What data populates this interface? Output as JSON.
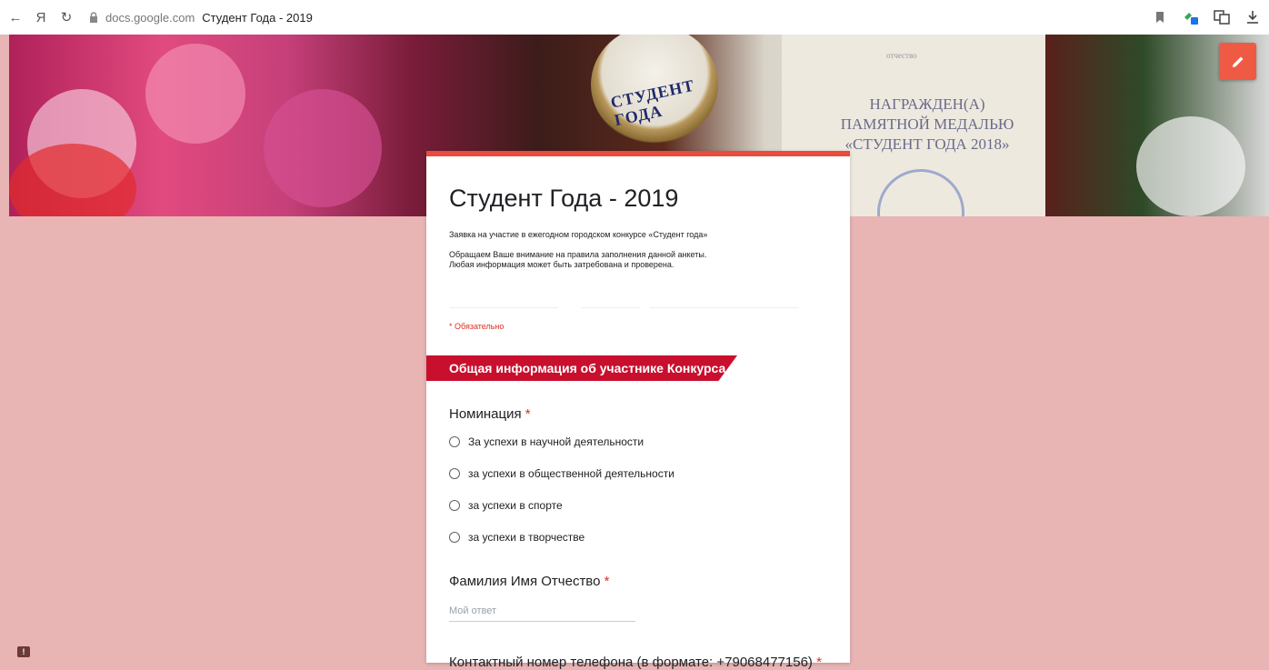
{
  "browser": {
    "back_icon": "←",
    "ya_icon": "Я",
    "reload_icon": "↻",
    "domain": "docs.google.com",
    "tab_title": "Студент Года - 2019"
  },
  "banner": {
    "medal_text": "СТУДЕНТ\nГОДА",
    "cert_small": "отчество",
    "cert_text": "НАГРАЖДЕН(А)\nПАМЯТНОЙ МЕДАЛЬЮ\n«СТУДЕНТ ГОДА 2018»"
  },
  "form": {
    "title": "Студент Года - 2019",
    "description": "Заявка на участие в ежегодном городском конкурсе «Студент года»",
    "description2_line1": "Обращаем Ваше внимание на правила заполнения данной анкеты.",
    "description2_line2": "Любая информация может быть затребована и проверена.",
    "required_note": "* Обязательно",
    "section_title": "Общая информация об участнике Конкурса",
    "questions": {
      "nomination": {
        "label": "Номинация",
        "required": "*",
        "options": [
          "За успехи в научной деятельности",
          "за успехи в общественной деятельности",
          "за успехи в спорте",
          "за успехи в творчестве"
        ]
      },
      "fio": {
        "label": "Фамилия Имя Отчество",
        "required": "*",
        "placeholder": "Мой ответ"
      },
      "phone": {
        "label": "Контактный номер телефона (в формате: +79068477156)",
        "required": "*"
      }
    }
  },
  "colors": {
    "accent": "#e94b3c",
    "section": "#c8102e",
    "page_bg": "#e8b4b4"
  }
}
